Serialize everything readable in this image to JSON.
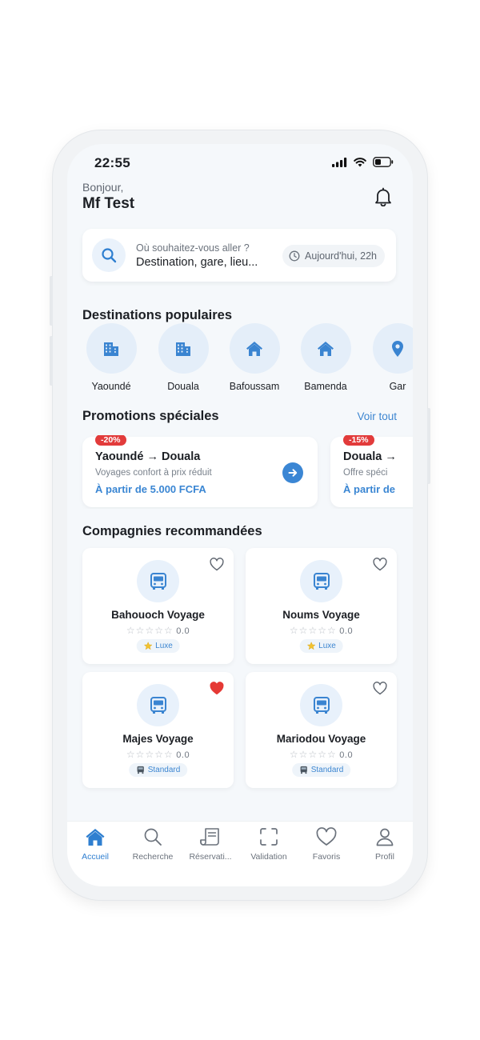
{
  "status": {
    "time": "22:55"
  },
  "greeting": {
    "hello": "Bonjour,",
    "name": "Mf Test"
  },
  "search": {
    "hint": "Où souhaitez-vous aller ?",
    "value": "Destination, gare, lieu...",
    "date": "Aujourd'hui, 22h"
  },
  "destinations": {
    "title": "Destinations populaires",
    "items": [
      {
        "label": "Yaoundé",
        "icon": "city-icon"
      },
      {
        "label": "Douala",
        "icon": "city-icon"
      },
      {
        "label": "Bafoussam",
        "icon": "home-icon"
      },
      {
        "label": "Bamenda",
        "icon": "home-icon"
      },
      {
        "label": "Gar",
        "icon": "location-pin-icon"
      }
    ]
  },
  "promotions": {
    "title": "Promotions spéciales",
    "see_all": "Voir tout",
    "items": [
      {
        "badge": "-20%",
        "route": "Yaoundé → Douala",
        "desc": "Voyages confort à prix réduit",
        "price": "À partir de 5.000 FCFA"
      },
      {
        "badge": "-15%",
        "route": "Douala →",
        "desc": "Offre spéci",
        "price": "À partir de"
      }
    ]
  },
  "companies": {
    "title": "Compagnies recommandées",
    "items": [
      {
        "name": "Bahouoch Voyage",
        "stars": "☆☆☆☆☆",
        "rating": "0.0",
        "tag": "Luxe",
        "tag_icon": "star-badge-icon",
        "favorite": false
      },
      {
        "name": "Noums Voyage",
        "stars": "☆☆☆☆☆",
        "rating": "0.0",
        "tag": "Luxe",
        "tag_icon": "star-badge-icon",
        "favorite": false
      },
      {
        "name": "Majes Voyage",
        "stars": "☆☆☆☆☆",
        "rating": "0.0",
        "tag": "Standard",
        "tag_icon": "bus-small-icon",
        "favorite": true
      },
      {
        "name": "Mariodou Voyage",
        "stars": "☆☆☆☆☆",
        "rating": "0.0",
        "tag": "Standard",
        "tag_icon": "bus-small-icon",
        "favorite": false
      }
    ]
  },
  "nav": {
    "items": [
      {
        "label": "Accueil",
        "icon": "home-icon",
        "active": true
      },
      {
        "label": "Recherche",
        "icon": "search-icon",
        "active": false
      },
      {
        "label": "Réservati...",
        "icon": "receipt-icon",
        "active": false
      },
      {
        "label": "Validation",
        "icon": "scan-icon",
        "active": false
      },
      {
        "label": "Favoris",
        "icon": "heart-icon",
        "active": false
      },
      {
        "label": "Profil",
        "icon": "user-icon",
        "active": false
      }
    ]
  },
  "colors": {
    "accent": "#3B86D4",
    "badge": "#E23B3B",
    "favorite": "#E53935",
    "background": "#F5F8FB"
  }
}
